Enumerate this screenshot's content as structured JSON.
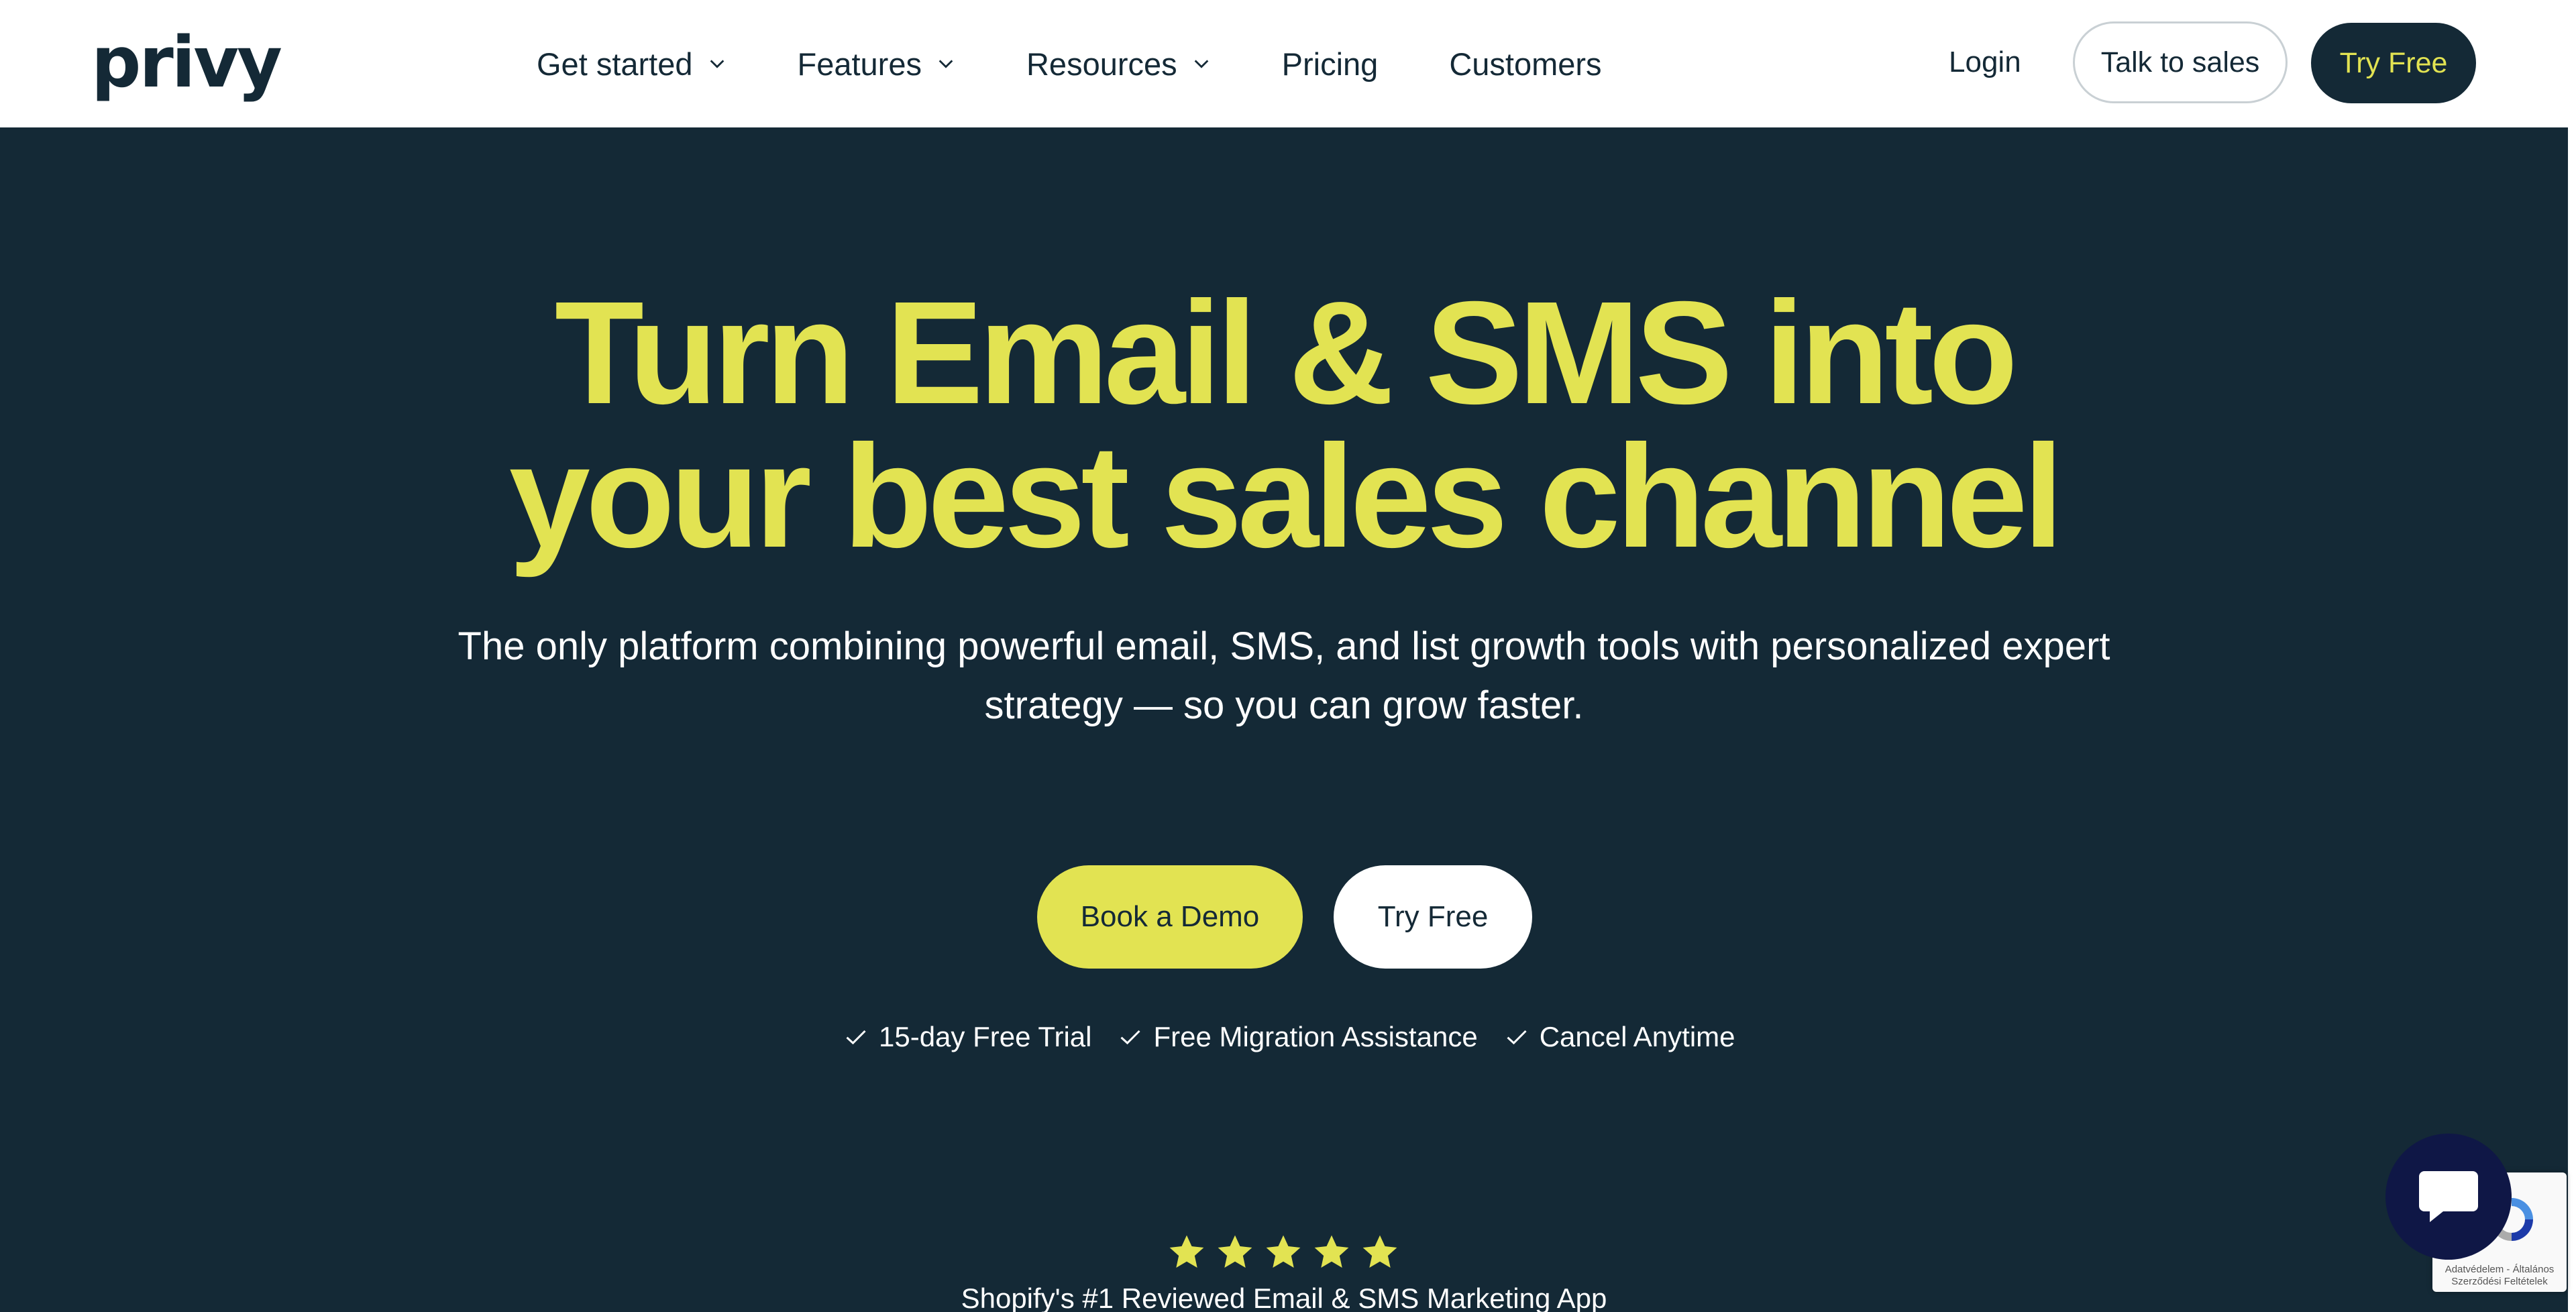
{
  "header": {
    "logo": "privy",
    "nav": [
      {
        "label": "Get started",
        "has_dropdown": true
      },
      {
        "label": "Features",
        "has_dropdown": true
      },
      {
        "label": "Resources",
        "has_dropdown": true
      },
      {
        "label": "Pricing",
        "has_dropdown": false
      },
      {
        "label": "Customers",
        "has_dropdown": false
      }
    ],
    "login": "Login",
    "talk_to_sales": "Talk to sales",
    "try_free": "Try Free"
  },
  "hero": {
    "title_line1": "Turn Email & SMS into",
    "title_line2": "your best sales channel",
    "subtitle_line1": "The only platform combining powerful email, SMS, and list growth tools with personalized expert",
    "subtitle_line2": "strategy — so you can grow faster.",
    "cta_primary": "Book a Demo",
    "cta_secondary": "Try Free",
    "perks": [
      "15-day Free Trial",
      "Free Migration Assistance",
      "Cancel Anytime"
    ],
    "rating_stars": 5,
    "rating_text": "Shopify's #1 Reviewed Email & SMS Marketing App"
  },
  "widgets": {
    "recaptcha_text": "Adatvédelem - Általános Szerződési Feltételek",
    "chat_icon": "chat-icon"
  },
  "colors": {
    "brand_dark": "#142936",
    "brand_accent": "#e2e352",
    "chat_bubble": "#0f1746"
  }
}
